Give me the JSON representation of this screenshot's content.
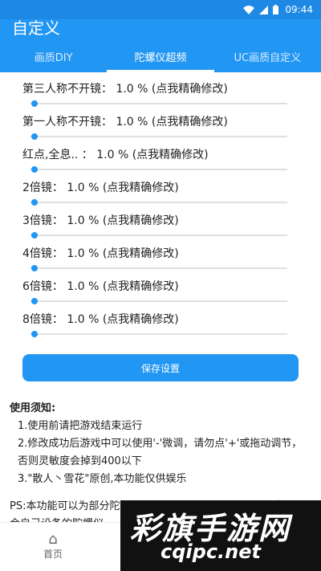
{
  "statusbar": {
    "time": "09:44",
    "wifi_icon": "wifi-icon",
    "signal_icon": "signal-icon",
    "battery_icon": "battery-icon"
  },
  "appbar": {
    "title": "自定义"
  },
  "tabs": [
    {
      "label": "画质DIY",
      "active": false
    },
    {
      "label": "陀螺仪超频",
      "active": true
    },
    {
      "label": "UC画质自定义",
      "active": false
    }
  ],
  "sliders": [
    {
      "label": "第三人称不开镜： 1.0 % (点我精确修改)",
      "value": 1.0
    },
    {
      "label": "第一人称不开镜： 1.0 % (点我精确修改)",
      "value": 1.0
    },
    {
      "label": "红点,全息.. ： 1.0 % (点我精确修改)",
      "value": 1.0
    },
    {
      "label": "2倍镜： 1.0 % (点我精确修改)",
      "value": 1.0
    },
    {
      "label": "3倍镜： 1.0 % (点我精确修改)",
      "value": 1.0
    },
    {
      "label": "4倍镜： 1.0 % (点我精确修改)",
      "value": 1.0
    },
    {
      "label": "6倍镜： 1.0 % (点我精确修改)",
      "value": 1.0
    },
    {
      "label": "8倍镜： 1.0 % (点我精确修改)",
      "value": 1.0
    }
  ],
  "save_button": "保存设置",
  "notes": {
    "heading": "使用须知:",
    "items": [
      "1.使用前请把游戏结束运行",
      "2.修改成功后游戏中可以使用'-'微调，请勿点'+'或拖动调节，否则灵敏度会掉到400以下",
      "3.\"散人丶雪花\"原创,本功能仅供娱乐"
    ],
    "ps": "PS:本功能可以为部分陀螺仪不灵敏的用户进行调整优化，找到适合自己设备的陀螺仪"
  },
  "bottom_nav": {
    "home_label": "首页",
    "home_icon": "home-icon"
  },
  "watermark": {
    "line1": "彩旗手游网",
    "line2": "cqipc.net"
  },
  "colors": {
    "primary": "#2196f3",
    "status": "#1e88e5"
  }
}
